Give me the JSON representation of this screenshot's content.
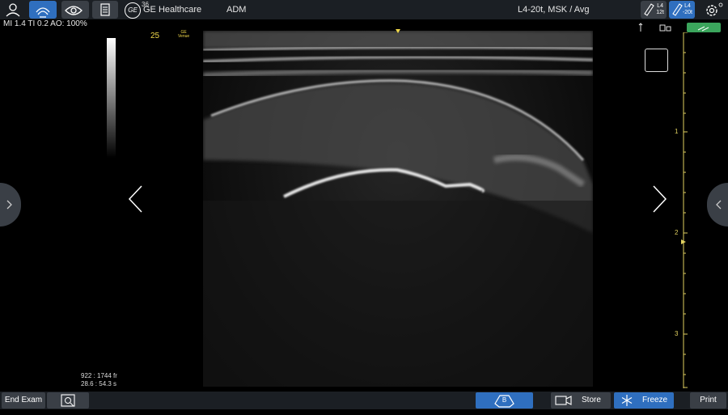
{
  "topbar": {
    "view_badge": "36",
    "brand_logo": "GE",
    "brand_name": "GE Healthcare",
    "operator": "ADM",
    "probe_preset": "L4-20t, MSK / Avg",
    "probe_tags": [
      {
        "line1": "L4",
        "line2": "12t"
      },
      {
        "line1": "L4",
        "line2": "-20t"
      }
    ],
    "icons": [
      "patient-icon",
      "probe-scan-icon",
      "eye-icon",
      "report-icon",
      "probe-tag-icon",
      "probe-tag-icon",
      "settings-gear-icon"
    ]
  },
  "params": {
    "text": "MI 1.4   TI 0.2   AO: 100%"
  },
  "overlay": {
    "frame_number": "25",
    "venue_line1": "GE",
    "venue_line2": "Venue"
  },
  "depth_scale": [
    "1",
    "2",
    "3"
  ],
  "cine": {
    "frames": "922 : 1744 fr",
    "time": "28.6 : 54.3 s"
  },
  "bottombar": {
    "end_exam": "End Exam",
    "mode": "B",
    "store": "Store",
    "freeze": "Freeze",
    "print": "Print"
  },
  "colors": {
    "accent_blue": "#2f6fbf",
    "bar_gray": "#1b1f24",
    "button_gray": "#3a3f46",
    "marker_yellow": "#f0d84a",
    "battery_green": "#3ba55c"
  }
}
